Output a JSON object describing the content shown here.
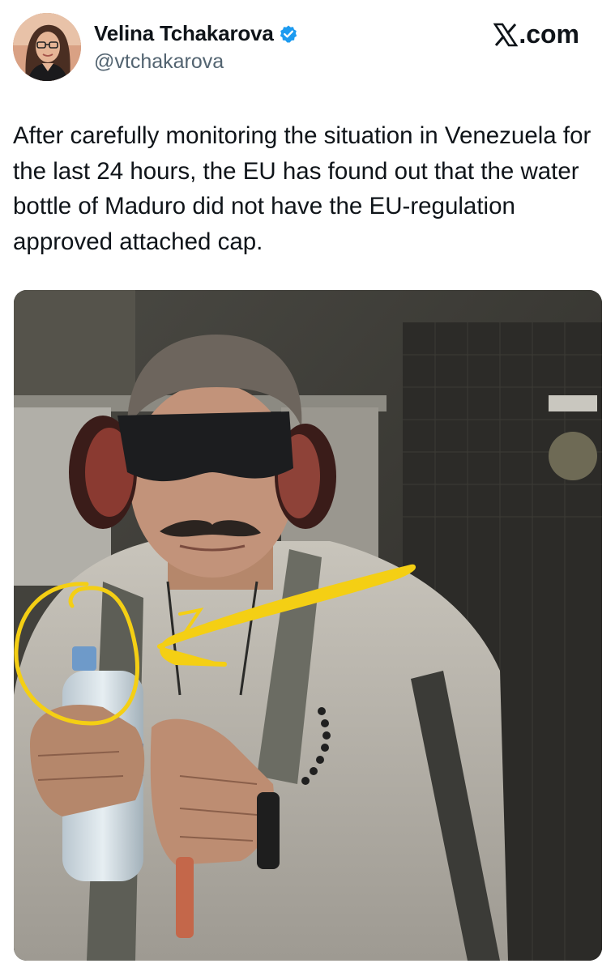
{
  "tweet": {
    "author": {
      "display_name": "Velina Tchakarova",
      "handle": "@vtchakarova",
      "verified": true,
      "verified_color": "#1d9bf0",
      "avatar_icon": "profile-photo"
    },
    "site_brand": ".com",
    "site_logo_icon": "x-logo-icon",
    "text": "After carefully monitoring the situation in Venezuela for the last 24 hours, the EU has found out that the water bottle of Maduro did not have the EU-regulation approved attached cap.",
    "media": {
      "kind": "photo",
      "annotation_color": "#f4cf14"
    }
  }
}
